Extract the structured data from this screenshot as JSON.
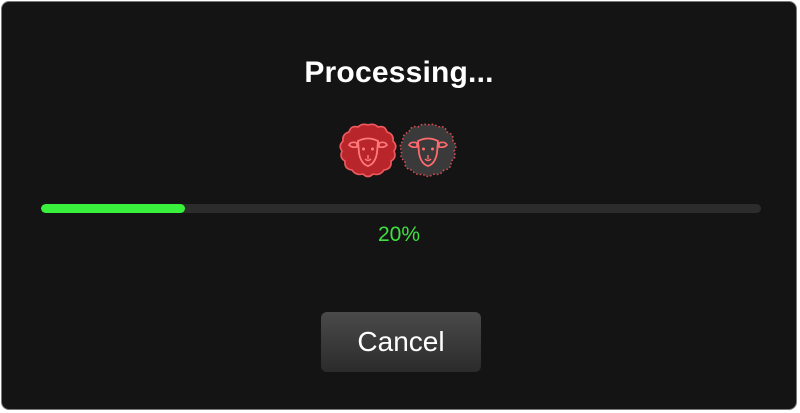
{
  "dialog": {
    "title": "Processing...",
    "progress": {
      "value": 20,
      "max": 100,
      "label": "20%"
    },
    "icons": [
      "sheep-icon",
      "sheep-icon"
    ],
    "cancel_label": "Cancel"
  },
  "colors": {
    "background": "#141414",
    "border": "#7a7a7a",
    "progress_fill": "#39f03c",
    "progress_track": "#2c2c2c",
    "percent_text": "#3fe040",
    "sheep_active": "#e0474c",
    "sheep_inactive": "#3a3a3a"
  }
}
